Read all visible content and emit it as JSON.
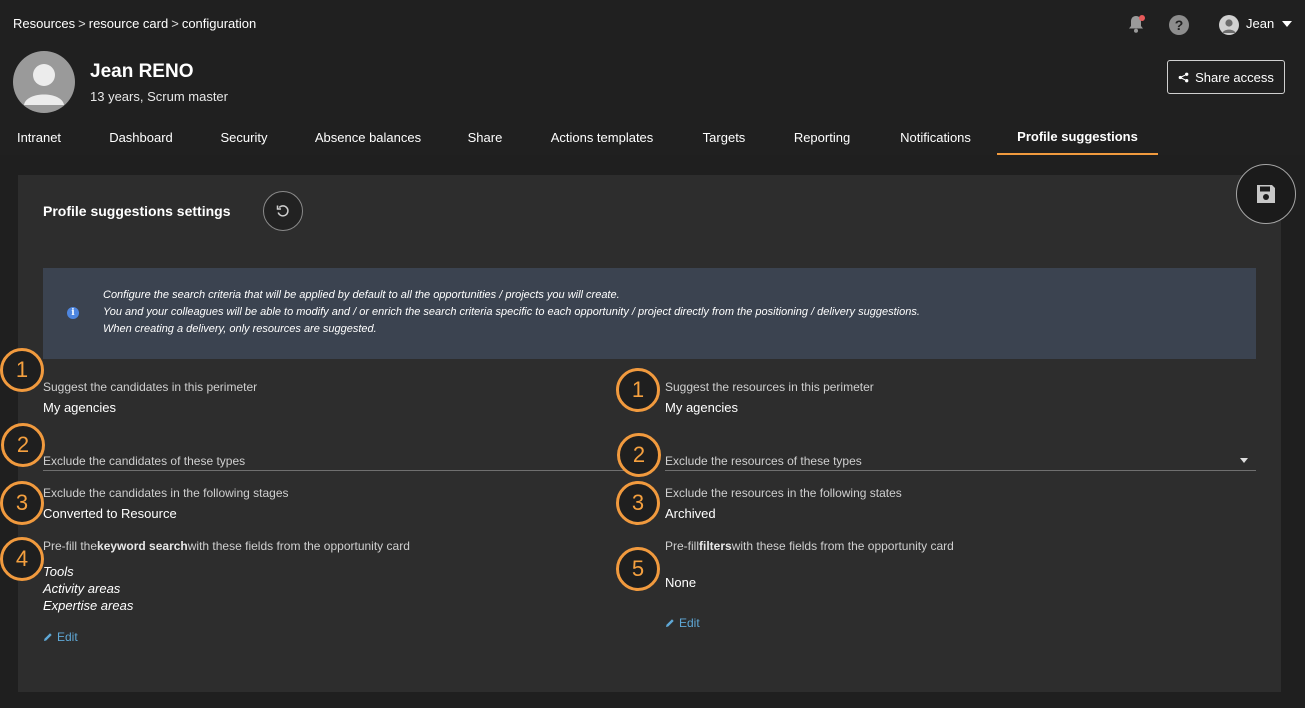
{
  "breadcrumb": [
    "Resources",
    "resource card",
    "configuration"
  ],
  "breadcrumb_sep": ">",
  "header": {
    "user_name": "Jean",
    "help_glyph": "?",
    "profile_name": "Jean RENO",
    "profile_sub": "13 years, Scrum master",
    "share_label": "Share access"
  },
  "tabs": [
    {
      "label": "Intranet"
    },
    {
      "label": "Dashboard"
    },
    {
      "label": "Security"
    },
    {
      "label": "Absence balances"
    },
    {
      "label": "Share"
    },
    {
      "label": "Actions templates"
    },
    {
      "label": "Targets"
    },
    {
      "label": "Reporting"
    },
    {
      "label": "Notifications"
    },
    {
      "label": "Profile suggestions",
      "active": true
    }
  ],
  "panel": {
    "title": "Profile suggestions settings",
    "info_glyph": "i",
    "info_lines": [
      "Configure the search criteria that will be applied by default to all the opportunities / projects you will create.",
      "You and your colleagues will be able to modify and / or enrich the search criteria specific to each opportunity / project directly from the positioning / delivery suggestions.",
      "When creating a delivery, only resources are suggested."
    ]
  },
  "left": {
    "perimeter_label": "Suggest the candidates in this perimeter",
    "perimeter_value": "My agencies",
    "exclude_types_label": "Exclude the candidates of these types",
    "exclude_stages_label": "Exclude the candidates in the following stages",
    "exclude_stages_value": "Converted to Resource",
    "prefill_prefix": "Pre-fill the",
    "prefill_bold": "keyword search",
    "prefill_suffix": "with these fields from the opportunity card",
    "prefill_values": [
      "Tools",
      "Activity areas",
      "Expertise areas"
    ],
    "edit_label": "Edit"
  },
  "right": {
    "perimeter_label": "Suggest the resources in this perimeter",
    "perimeter_value": "My agencies",
    "exclude_types_label": "Exclude the resources of these types",
    "exclude_states_label": "Exclude the resources in the following states",
    "exclude_states_value": "Archived",
    "prefill_prefix": "Pre-fill",
    "prefill_bold": "filters",
    "prefill_suffix": "with these fields from the opportunity card",
    "prefill_value": "None",
    "edit_label": "Edit"
  },
  "callouts": {
    "left": [
      "1",
      "2",
      "3",
      "4"
    ],
    "right": [
      "1",
      "2",
      "3",
      "5"
    ]
  },
  "colors": {
    "accent": "#f19a3e",
    "link": "#5fa8d6",
    "info_bg": "#3b4350",
    "panel_bg": "#2d2d2d",
    "page_bg": "#1f1f1f"
  }
}
